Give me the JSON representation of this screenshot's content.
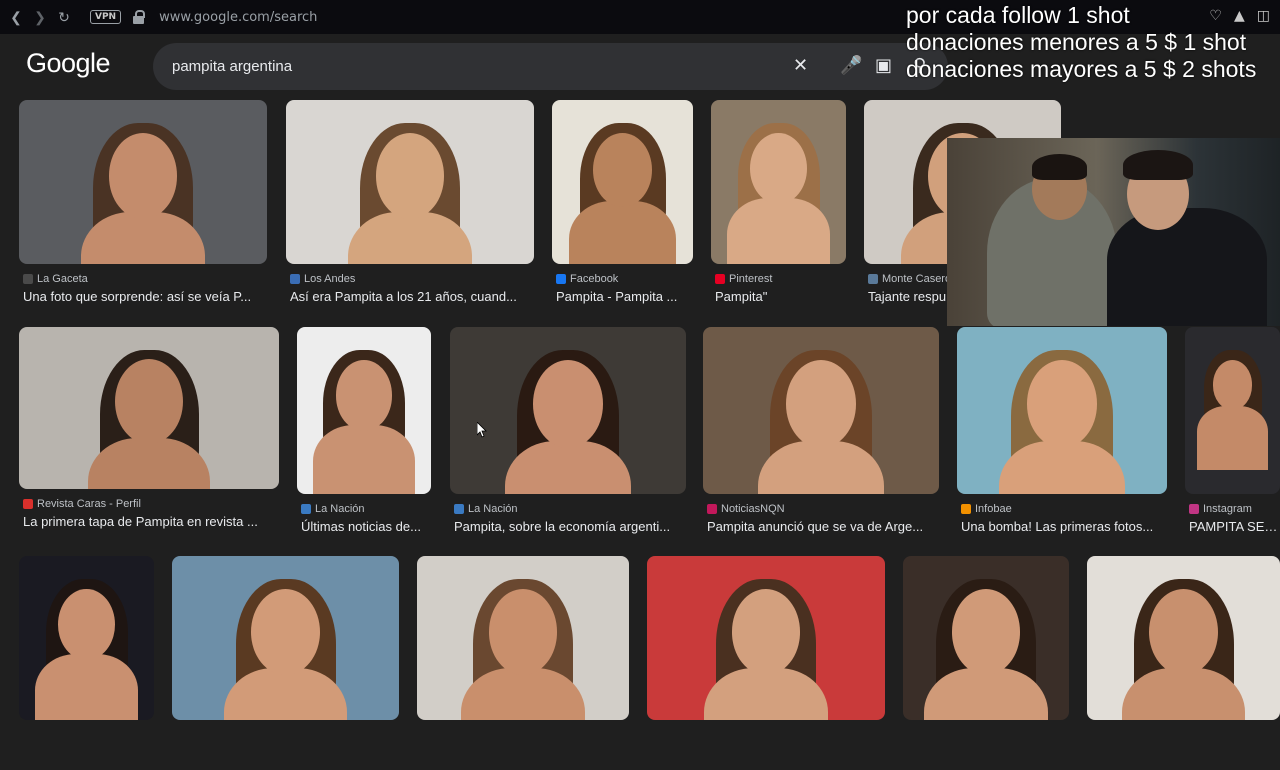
{
  "browser": {
    "vpn_label": "VPN",
    "url": "www.google.com/search"
  },
  "overlay": {
    "lines": [
      "por cada follow 1 shot",
      "donaciones menores a 5 $ 1 shot",
      "donaciones mayores a 5 $ 2 shots"
    ]
  },
  "header": {
    "logo": "Google",
    "query": "pampita argentina"
  },
  "results": [
    {
      "source": "La Gaceta",
      "title": "Una foto que sorprende: así se veía P...",
      "fav": "#4a4a4a",
      "bg": "#5a5c60",
      "skin": "#c48c6c",
      "hair": "#4a3324"
    },
    {
      "source": "Los Andes",
      "title": "Así era Pampita a los 21 años, cuand...",
      "fav": "#3a6db5",
      "bg": "#d9d6d2",
      "skin": "#d4a57e",
      "hair": "#6a4a30"
    },
    {
      "source": "Facebook",
      "title": "Pampita - Pampita ...",
      "fav": "#1877f2",
      "bg": "#e6e2d8",
      "skin": "#b9835c",
      "hair": "#5a3a22"
    },
    {
      "source": "Pinterest",
      "title": "Pampita\"",
      "fav": "#e60023",
      "bg": "#8a7a66",
      "skin": "#d9a986",
      "hair": "#9c7048"
    },
    {
      "source": "Monte Casero",
      "title": "Tajante respu",
      "fav": "#5a7a9a",
      "bg": "#cfcac4",
      "skin": "#d1a07c",
      "hair": "#3a2a1e"
    },
    {
      "source": "Revista Caras - Perfil",
      "title": "La primera tapa de Pampita en revista ...",
      "fav": "#d9302c",
      "bg": "#b8b4ae",
      "skin": "#b88262",
      "hair": "#2a1f18"
    },
    {
      "source": "La Nación",
      "title": "Últimas noticias de...",
      "fav": "#3a7ac2",
      "bg": "#ededed",
      "skin": "#c99272",
      "hair": "#3b271a"
    },
    {
      "source": "La Nación",
      "title": "Pampita, sobre la economía argenti...",
      "fav": "#3a7ac2",
      "bg": "#3e3a36",
      "skin": "#c98f70",
      "hair": "#2a1a12"
    },
    {
      "source": "NoticiasNQN",
      "title": "Pampita anunció que se va de Arge...",
      "fav": "#c2185b",
      "bg": "#6e5a48",
      "skin": "#d3a07e",
      "hair": "#6b4428"
    },
    {
      "source": "Infobae",
      "title": "Una bomba! Las primeras fotos...",
      "fav": "#f29100",
      "bg": "#7fb1c2",
      "skin": "#d9a07a",
      "hair": "#8a6a40"
    },
    {
      "source": "Instagram",
      "title": "PAMPITA SERA",
      "fav": "#c13584",
      "bg": "#2a2a2e",
      "skin": "#c48a68",
      "hair": "#3a2618"
    },
    {
      "source": "",
      "title": "",
      "fav": "#000",
      "bg": "#1a1a22",
      "skin": "#c99070",
      "hair": "#1e1512"
    },
    {
      "source": "",
      "title": "",
      "fav": "#000",
      "bg": "#6d8fa8",
      "skin": "#d29b78",
      "hair": "#5a3a22"
    },
    {
      "source": "",
      "title": "",
      "fav": "#000",
      "bg": "#d2cec8",
      "skin": "#c98f6c",
      "hair": "#6a4830"
    },
    {
      "source": "",
      "title": "",
      "fav": "#000",
      "bg": "#c93a3a",
      "skin": "#d3a07e",
      "hair": "#4a3020"
    },
    {
      "source": "",
      "title": "",
      "fav": "#000",
      "bg": "#3a2e28",
      "skin": "#d09a78",
      "hair": "#2a1c14"
    },
    {
      "source": "",
      "title": "",
      "fav": "#000",
      "bg": "#e2ded8",
      "skin": "#c8906e",
      "hair": "#3a2618"
    }
  ]
}
